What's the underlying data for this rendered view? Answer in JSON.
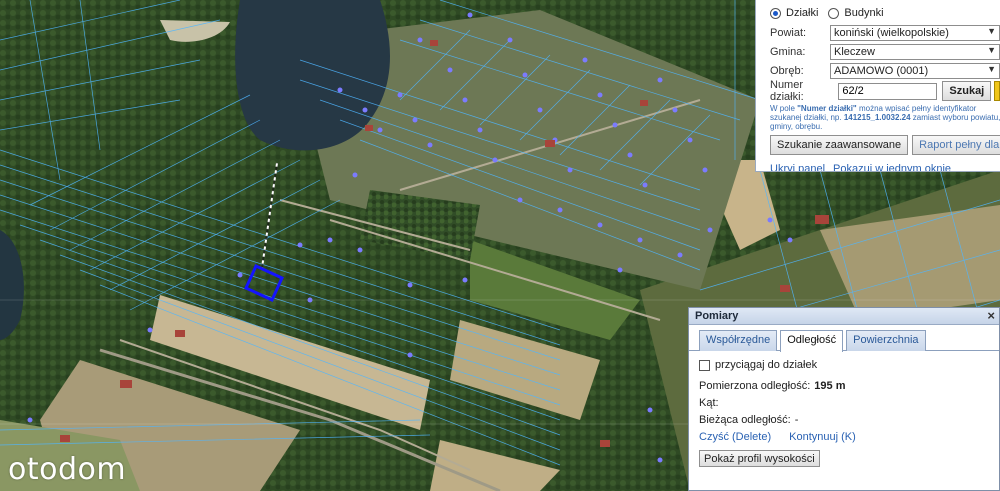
{
  "watermark": "otodom",
  "search_panel": {
    "radio_parcels": "Działki",
    "radio_buildings": "Budynki",
    "county_label": "Powiat:",
    "county_value": "koniński (wielkopolskie)",
    "commune_label": "Gmina:",
    "commune_value": "Kleczew",
    "precinct_label": "Obręb:",
    "precinct_value": "ADAMOWO (0001)",
    "parcel_label": "Numer działki:",
    "parcel_value": "62/2",
    "search_button": "Szukaj",
    "hint_prefix": "W pole ",
    "hint_field": "\"Numer działki\"",
    "hint_middle": " można wpisać pełny identyfikator szukanej działki, np. ",
    "hint_example": "141215_1.0032.24",
    "hint_suffix": " zamiast wyboru powiatu, gminy, obrębu.",
    "advanced_search_button": "Szukanie zaawansowane",
    "report_button": "Raport pełny dla działki",
    "hide_panel_link": "Ukryj panel",
    "single_window_link": "Pokazuj w jednym oknie"
  },
  "measure_panel": {
    "title": "Pomiary",
    "close": "×",
    "tabs": [
      {
        "label": "Współrzędne"
      },
      {
        "label": "Odległość"
      },
      {
        "label": "Powierzchnia"
      }
    ],
    "snap_label": "przyciągaj do działek",
    "measured_label": "Pomierzona odległość:",
    "measured_value": "195 m",
    "angle_label": "Kąt:",
    "current_label": "Bieżąca odległość:",
    "current_value": "-",
    "clear_link": "Czyść (Delete)",
    "continue_link": "Kontynuuj (K)",
    "profile_button": "Pokaż profil wysokości"
  }
}
